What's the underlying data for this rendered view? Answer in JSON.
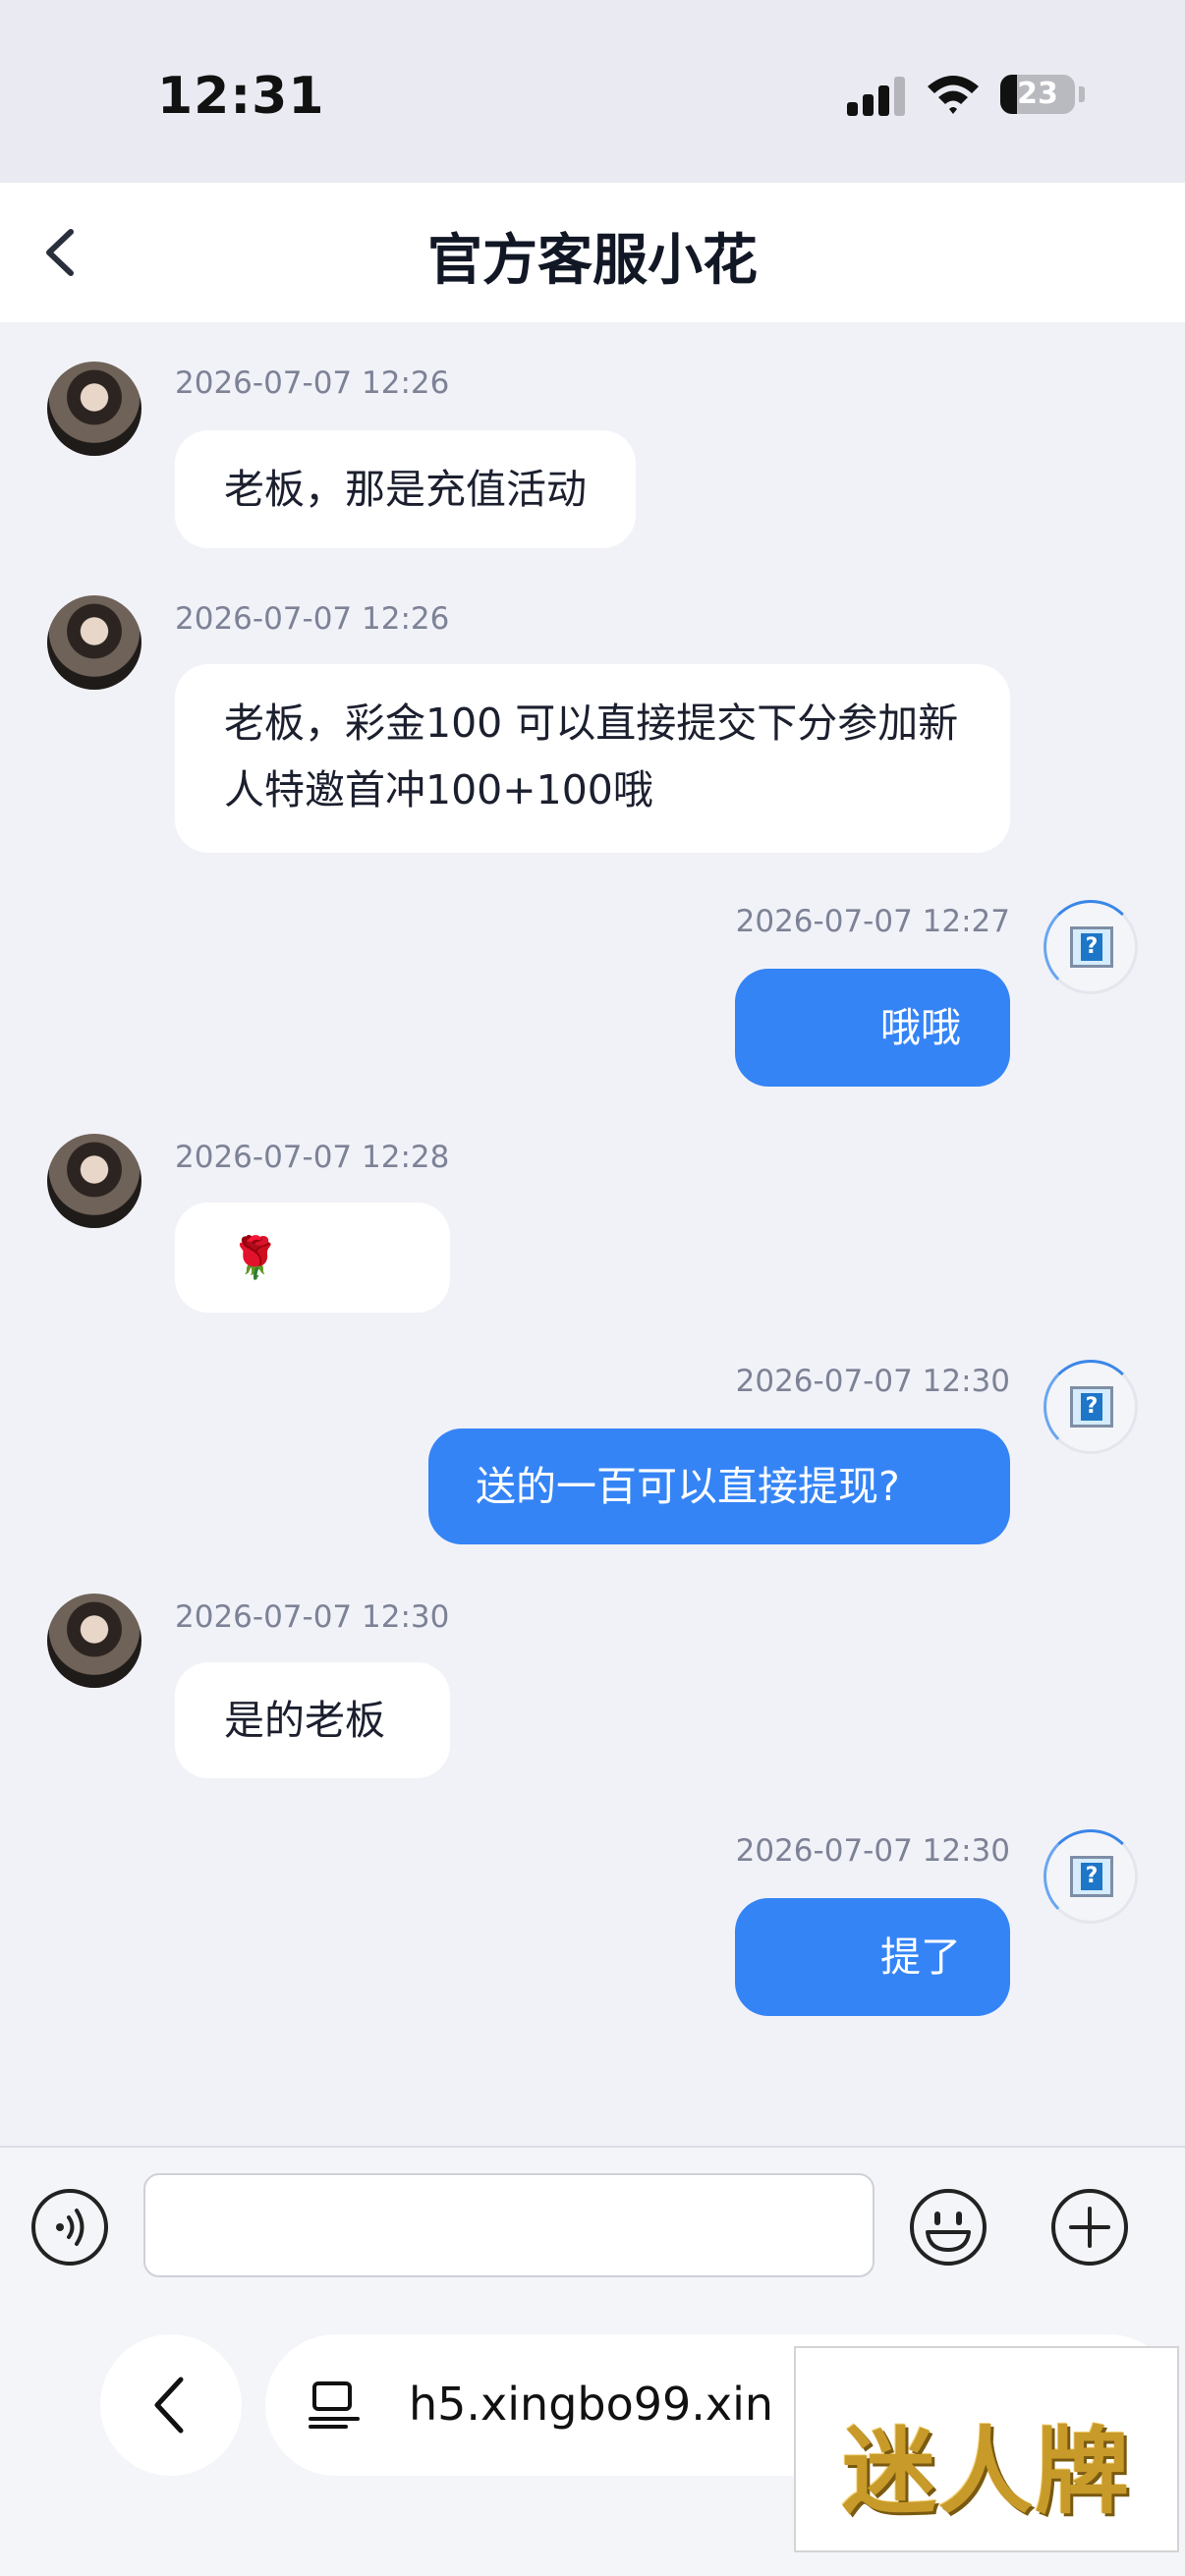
{
  "status_bar": {
    "time": "12:31",
    "battery_level": "23"
  },
  "nav": {
    "title": "官方客服小花",
    "back_icon": "chevron-left-icon"
  },
  "messages": [
    {
      "sender": "agent",
      "time": "2026-07-07 12:26",
      "text": "老板，那是充值活动"
    },
    {
      "sender": "agent",
      "time": "2026-07-07 12:26",
      "text": "老板，彩金100 可以直接提交下分参加新人特邀首冲100+100哦"
    },
    {
      "sender": "user",
      "time": "2026-07-07 12:27",
      "text": "哦哦"
    },
    {
      "sender": "agent",
      "time": "2026-07-07 12:28",
      "text": "🌹"
    },
    {
      "sender": "user",
      "time": "2026-07-07 12:30",
      "text": "送的一百可以直接提现?"
    },
    {
      "sender": "agent",
      "time": "2026-07-07 12:30",
      "text": "是的老板"
    },
    {
      "sender": "user",
      "time": "2026-07-07 12:30",
      "text": "提了"
    }
  ],
  "input": {
    "value": "",
    "voice_icon": "voice-icon",
    "emoji_icon": "emoji-icon",
    "plus_icon": "plus-icon"
  },
  "browser": {
    "url": "h5.xingbo99.xin",
    "back_icon": "chevron-left-icon"
  },
  "watermark": {
    "text": "迷人牌"
  },
  "colors": {
    "accent": "#3584f6",
    "background": "#f1f2f8",
    "incoming_bubble": "#ffffff"
  }
}
